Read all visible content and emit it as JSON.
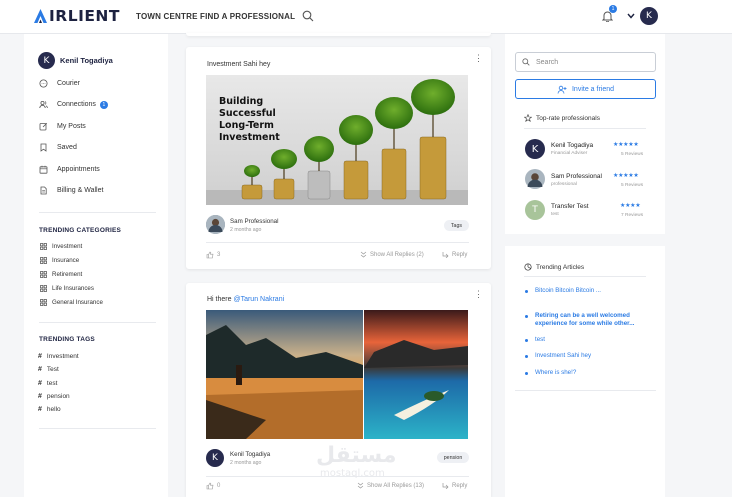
{
  "header": {
    "logo_text": "IRLIENT",
    "nav": [
      "TOWN CENTRE",
      "FIND A PROFESSIONAL"
    ],
    "notification_count": "1",
    "user_initial": "K"
  },
  "profile": {
    "initial": "K",
    "name": "Kenil Togadiya"
  },
  "menu": [
    {
      "label": "Courier",
      "icon": "chat-icon"
    },
    {
      "label": "Connections",
      "icon": "users-icon",
      "badge": "1"
    },
    {
      "label": "My Posts",
      "icon": "edit-icon"
    },
    {
      "label": "Saved",
      "icon": "bookmark-icon"
    },
    {
      "label": "Appointments",
      "icon": "calendar-icon"
    },
    {
      "label": "Billing & Wallet",
      "icon": "document-icon"
    }
  ],
  "trending_categories": {
    "title": "TRENDING CATEGORIES",
    "items": [
      "Investment",
      "Insurance",
      "Retirement",
      "Life Insurances",
      "General Insurance"
    ]
  },
  "trending_tags": {
    "title": "TRENDING TAGS",
    "items": [
      "Investment",
      "Test",
      "test",
      "pension",
      "hello"
    ]
  },
  "posts": [
    {
      "title": "Investment Sahi hey",
      "image_text": [
        "Building",
        "Successful",
        "Long-Term",
        "Investment"
      ],
      "author": "Sam Professional",
      "time": "2 months ago",
      "tag": "Tags",
      "likes": "3",
      "replies": "Show All Replies (2)",
      "reply": "Reply"
    },
    {
      "title_prefix": "Hi there ",
      "mention": "@Tarun Nakrani",
      "author": "Kenil Togadiya",
      "author_initial": "K",
      "time": "2 months ago",
      "tag": "pension",
      "likes": "0",
      "replies": "Show All Replies (13)",
      "reply": "Reply"
    }
  ],
  "right": {
    "search_placeholder": "Search",
    "invite_label": "Invite a friend",
    "top_rated_title": "Top-rate professionals",
    "professionals": [
      {
        "initial": "K",
        "name": "Kenil Togadiya",
        "role": "Financial Adviser",
        "stars": "★★★★★",
        "reviews": "5 Reviews"
      },
      {
        "name": "Sam Professional",
        "role": "professional",
        "stars": "★★★★★",
        "reviews": "5 Reviews"
      },
      {
        "initial": "T",
        "name": "Transfer Test",
        "role": "test",
        "stars": "★★★★",
        "reviews": "7 Reviews"
      }
    ],
    "trending_articles_title": "Trending Articles",
    "articles": [
      {
        "text": "Bitcoin Bitcoin Bitcoin ...",
        "bold": false
      },
      {
        "text": "Retiring can be a well welcomed experience for some while other...",
        "bold": true
      },
      {
        "text": "test",
        "bold": false
      },
      {
        "text": "Investment Sahi hey",
        "bold": false
      },
      {
        "text": "Where is she!?",
        "bold": false
      }
    ]
  },
  "colors": {
    "brand_dark": "#1d2240",
    "accent": "#2b7be4",
    "background": "#f5f6f8"
  },
  "watermark": {
    "arabic": "مستقل",
    "latin": "mostaql.com"
  }
}
